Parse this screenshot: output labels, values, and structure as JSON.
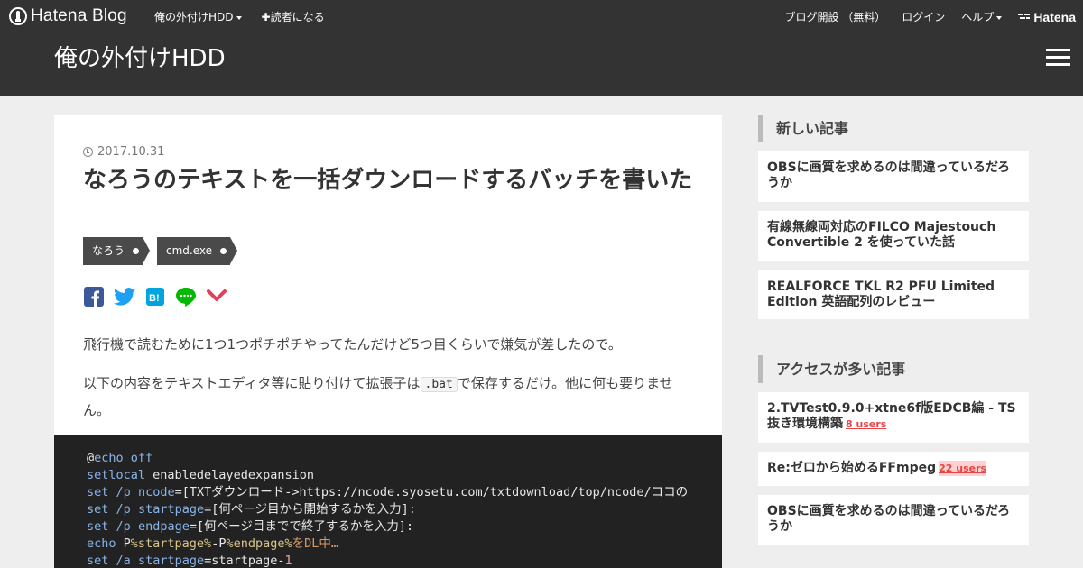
{
  "header": {
    "logo_text": "Hatena Blog",
    "nav_left": [
      {
        "label": "俺の外付けHDD",
        "dropdown": true
      },
      {
        "label": "✚読者になる",
        "dropdown": false
      }
    ],
    "nav_right": [
      {
        "label": "ブログ開設 （無料）",
        "dropdown": false
      },
      {
        "label": "ログイン",
        "dropdown": false
      },
      {
        "label": "ヘルプ",
        "dropdown": true
      }
    ],
    "hatena_label": "Hatena",
    "blog_title": "俺の外付けHDD"
  },
  "article": {
    "date": "2017.10.31",
    "title": "なろうのテキストを一括ダウンロードするバッチを書いた",
    "tags": [
      "なろう",
      "cmd.exe"
    ],
    "share_icons": [
      "facebook-icon",
      "twitter-icon",
      "hatena-bookmark-icon",
      "line-icon",
      "pocket-icon"
    ],
    "para1": "飛行機で読むために1つ1つポチポチやってたんだけど5つ目くらいで嫌気が差したので。",
    "para2_before": "以下の内容をテキストエディタ等に貼り付けて拡張子は",
    "para2_code": ".bat",
    "para2_after": "で保存するだけ。他に何も要りません。",
    "code_lines": [
      "@echo off",
      "setlocal enabledelayedexpansion",
      "set /p ncode=[TXTダウンロード->https://ncode.syosetu.com/txtdownload/top/ncode/ココの",
      "set /p startpage=[何ページ目から開始するかを入力]:",
      "set /p endpage=[何ページ目までで終了するかを入力]:",
      "echo P%startpage%-P%endpage%をDL中…",
      "set /a startpage=startpage-1"
    ]
  },
  "sidebar": {
    "recent_heading": "新しい記事",
    "recent": [
      {
        "title": "OBSに画質を求めるのは間違っているだろうか"
      },
      {
        "title": "有線無線両対応のFILCO Majestouch Convertible 2 を使っていた話"
      },
      {
        "title": "REALFORCE TKL R2 PFU Limited Edition 英語配列のレビュー"
      }
    ],
    "popular_heading": "アクセスが多い記事",
    "popular": [
      {
        "title": "2.TVTest0.9.0+xtne6f版EDCB編 - TS抜き環境構築",
        "users": "8 users"
      },
      {
        "title": "Re:ゼロから始めるFFmpeg",
        "users": "22 users"
      },
      {
        "title": "OBSに画質を求めるのは間違っているだろうか",
        "users": ""
      }
    ]
  }
}
